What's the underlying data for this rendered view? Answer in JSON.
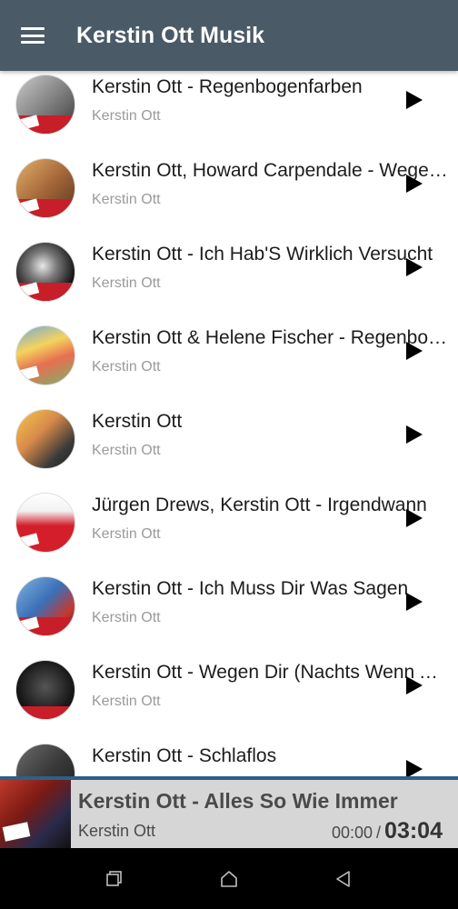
{
  "app": {
    "title": "Kerstin Ott Musik"
  },
  "songs": [
    {
      "title": "Kerstin Ott - Regenbogenfarben",
      "artist": "Kerstin Ott"
    },
    {
      "title": "Kerstin Ott, Howard Carpendale - Wegen Dir",
      "artist": "Kerstin Ott"
    },
    {
      "title": "Kerstin Ott - Ich Hab'S Wirklich Versucht",
      "artist": "Kerstin Ott"
    },
    {
      "title": "Kerstin Ott & Helene Fischer - Regenbogenfarben",
      "artist": "Kerstin Ott"
    },
    {
      "title": "Kerstin Ott",
      "artist": "Kerstin Ott"
    },
    {
      "title": "Jürgen Drews, Kerstin Ott - Irgendwann",
      "artist": "Kerstin Ott"
    },
    {
      "title": "Kerstin Ott - Ich Muss Dir Was Sagen",
      "artist": "Kerstin Ott"
    },
    {
      "title": "Kerstin Ott - Wegen Dir (Nachts Wenn Alles Schläft)",
      "artist": "Kerstin Ott"
    },
    {
      "title": "Kerstin Ott - Schlaflos",
      "artist": ""
    }
  ],
  "player": {
    "title": "Kerstin Ott - Alles So Wie Immer",
    "artist": "Kerstin Ott",
    "current_time": "00:00",
    "separator": "/",
    "duration": "03:04"
  },
  "icons": {
    "menu": "hamburger-icon",
    "play": "play-icon",
    "recents": "recents-icon",
    "home": "home-icon",
    "back": "back-icon"
  },
  "colors": {
    "appbar": "#4a5a66",
    "accent": "#c81e2a",
    "player_bg": "#d6d6d6",
    "progress": "#2e5f86"
  }
}
